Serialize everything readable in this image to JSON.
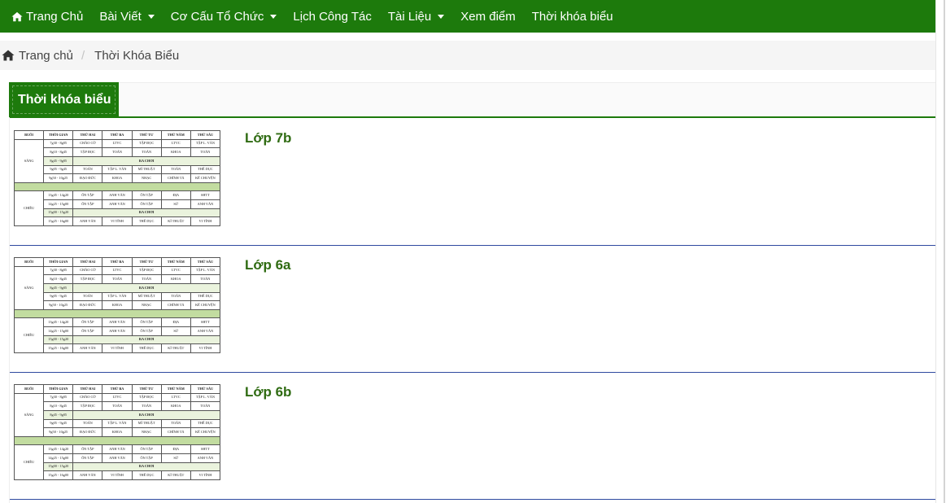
{
  "nav": {
    "items": [
      {
        "label": "Trang Chủ",
        "icon": "home-icon"
      },
      {
        "label": "Bài Viết",
        "dropdown": true
      },
      {
        "label": "Cơ Cấu Tổ Chức",
        "dropdown": true
      },
      {
        "label": "Lịch Công Tác"
      },
      {
        "label": "Tài Liệu",
        "dropdown": true
      },
      {
        "label": "Xem điểm"
      },
      {
        "label": "Thời khóa biểu"
      }
    ],
    "bg_color": "#1d7a0c"
  },
  "breadcrumb": {
    "home_label": "Trang chủ",
    "current": "Thời Khóa Biểu"
  },
  "panel": {
    "title": "Thời khóa biểu"
  },
  "timetable": {
    "headers": [
      "BUỔI",
      "THỜI GIAN",
      "THỨ HAI",
      "THỨ BA",
      "THỨ TƯ",
      "THỨ NĂM",
      "THỨ SÁU"
    ],
    "morning_label": "SÁNG",
    "afternoon_label": "CHIỀU",
    "break_label": "RA CHƠI",
    "morning": [
      {
        "time": "7g30 - 8g05",
        "cells": [
          "CHÀO CỜ",
          "LTVC",
          "TẬP ĐỌC",
          "LTVC",
          "TẬP L. VĂN"
        ]
      },
      {
        "time": "8g10 - 8g45",
        "cells": [
          "TẬP ĐỌC",
          "TOÁN",
          "TOÁN",
          "KHOA",
          "TOÁN"
        ]
      },
      {
        "time": "8g45 - 9g05",
        "cells": []
      },
      {
        "time": "9g05 - 9g45",
        "cells": [
          "TOÁN",
          "TẬP L. VĂN",
          "MĨ THUẬT",
          "TOÁN",
          "THỂ DỤC"
        ]
      },
      {
        "time": "9g50 - 10g25",
        "cells": [
          "ĐẠO ĐỨC",
          "KHOA",
          "NHẠC",
          "CHÍNH TẢ",
          "KỂ CHUYỆN"
        ]
      }
    ],
    "afternoon": [
      {
        "time": "13g45 - 14g20",
        "cells": [
          "ÔN TẬP",
          "ANH VĂN",
          "ÔN TẬP",
          "ĐỊA",
          "SHTT"
        ]
      },
      {
        "time": "14g25 - 15g00",
        "cells": [
          "ÔN TẬP",
          "ANH VĂN",
          "ÔN TẬP",
          "SỬ",
          "ANH VĂN"
        ]
      },
      {
        "time": "15g00 - 15g20",
        "cells": []
      },
      {
        "time": "15g25 - 16g00",
        "cells": [
          "ANH VĂN",
          "VI TÍNH",
          "THỂ DỤC",
          "KĨ THUẬT",
          "VI TÍNH"
        ]
      }
    ]
  },
  "classes": [
    {
      "name": "Lớp 7b"
    },
    {
      "name": "Lớp 6a"
    },
    {
      "name": "Lớp 6b"
    }
  ]
}
